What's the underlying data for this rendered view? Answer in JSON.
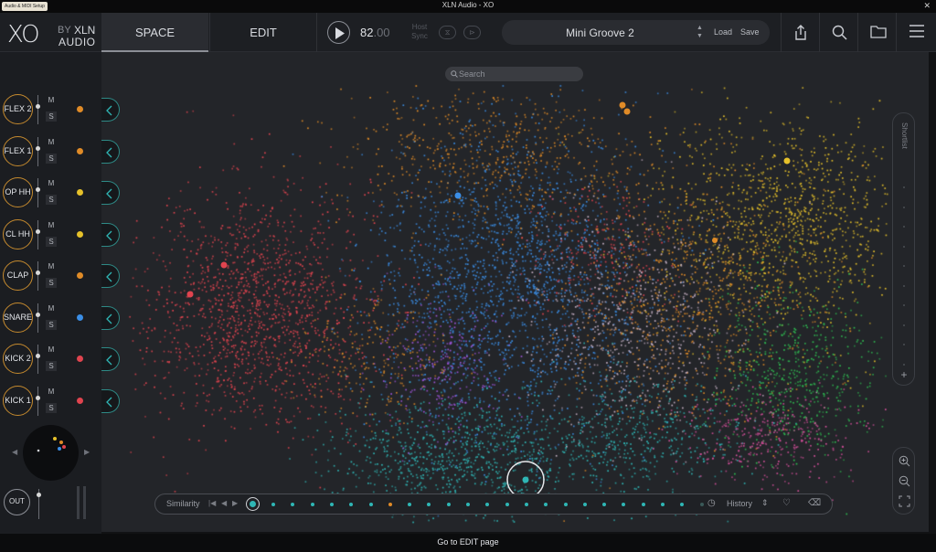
{
  "window": {
    "title": "XLN Audio - XO",
    "audio_setup_label": "Audio & MIDI Setup",
    "close_glyph": "✕"
  },
  "logo": {
    "xo": "XO",
    "by": "BY",
    "xln": "XLN",
    "audio": "AUDIO"
  },
  "tabs": [
    {
      "label": "SPACE",
      "active": true
    },
    {
      "label": "EDIT",
      "active": false
    }
  ],
  "transport": {
    "bpm_main": "82",
    "bpm_decimal": ".00",
    "host_sync_line1": "Host",
    "host_sync_line2": "Sync",
    "sync_icon_1": "⧖",
    "sync_icon_2": "⊳"
  },
  "preset": {
    "name": "Mini Groove 2",
    "load_label": "Load",
    "save_label": "Save",
    "up_glyph": "▲",
    "down_glyph": "▼"
  },
  "header_icons": [
    "share-icon",
    "search-icon",
    "folder-icon",
    "menu-icon"
  ],
  "slots": [
    {
      "label": "FLEX 2",
      "color": "#e08b27"
    },
    {
      "label": "FLEX 1",
      "color": "#e08b27"
    },
    {
      "label": "OP HH",
      "color": "#e6c12a"
    },
    {
      "label": "CL HH",
      "color": "#e6c12a"
    },
    {
      "label": "CLAP",
      "color": "#e08b27"
    },
    {
      "label": "SNARE",
      "color": "#3b8ee6"
    },
    {
      "label": "KICK 2",
      "color": "#e0444f"
    },
    {
      "label": "KICK 1",
      "color": "#e0444f"
    }
  ],
  "slot_controls": {
    "mute": "M",
    "solo": "S"
  },
  "output": {
    "label": "OUT",
    "left_arrow": "◀",
    "right_arrow": "▶"
  },
  "search": {
    "placeholder": "Search"
  },
  "shortlist": {
    "label": "Shortlist",
    "add_glyph": "+"
  },
  "similarity": {
    "label": "Similarity",
    "history_label": "History",
    "first_glyph": "|◀",
    "prev_glyph": "◀",
    "next_glyph": "▶",
    "updown_glyph": "⇕",
    "heart_glyph": "♡",
    "clear_glyph": "⌫",
    "clock_glyph": "◷"
  },
  "status_bar": {
    "text": "Go to EDIT page"
  },
  "colors": {
    "kick": "#e0444f",
    "snare": "#3b8ee6",
    "hat": "#e6c12a",
    "flex": "#e08b27",
    "accent": "#2fb6b5",
    "perc": "#9b54d6",
    "green": "#2fbf52",
    "pink": "#d5509b"
  }
}
